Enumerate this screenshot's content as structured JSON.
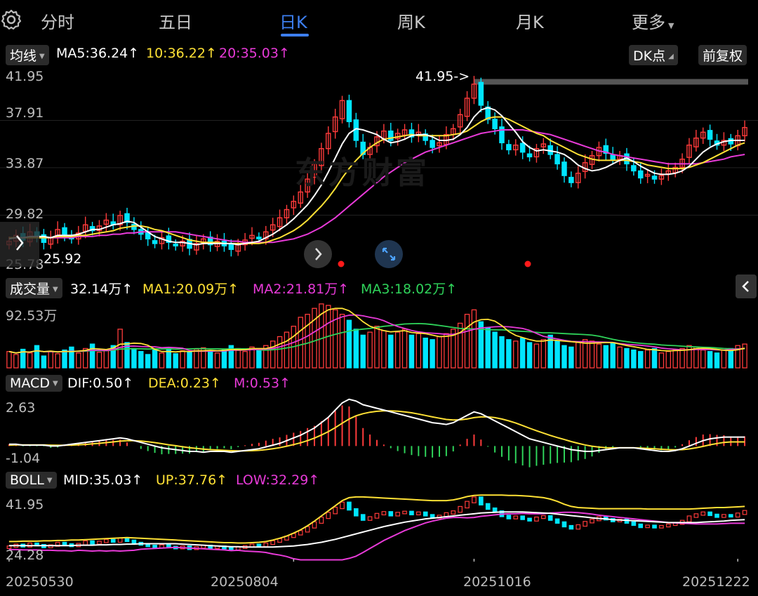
{
  "tabs": [
    "分时",
    "五日",
    "日K",
    "周K",
    "月K",
    "更多"
  ],
  "active_tab": 2,
  "main_legend": {
    "selector": "均线",
    "ma5": "MA5:36.24↑",
    "ma10": "10:36.22↑",
    "ma20": "20:35.03↑",
    "dk_button": "DK点",
    "fq_button": "前复权"
  },
  "main_axis": [
    "41.95",
    "37.91",
    "33.87",
    "29.82",
    "25.78"
  ],
  "annotations": {
    "high_label": "41.95->",
    "low_label": "25.92"
  },
  "watermark": "东方财富",
  "volume_legend": {
    "selector": "成交量",
    "value": "32.14万↑",
    "ma1": "MA1:20.09万↑",
    "ma2": "MA2:21.81万↑",
    "ma3": "MA3:18.02万↑",
    "axis_max": "92.53万"
  },
  "macd_legend": {
    "selector": "MACD",
    "dif": "DIF:0.50↑",
    "dea": "DEA:0.23↑",
    "m": "M:0.53↑",
    "axis_max": "2.63",
    "axis_min": "-1.04"
  },
  "boll_legend": {
    "selector": "BOLL",
    "mid": "MID:35.03↑",
    "up": "UP:37.76↑",
    "low": "LOW:32.29↑",
    "axis_max": "41.95",
    "axis_min": "24.28"
  },
  "dates": [
    "20250530",
    "20250804",
    "20251016",
    "20251222"
  ],
  "colors": {
    "up": "#ff3b3b",
    "down": "#00e5ff",
    "ma5": "#ffffff",
    "ma10": "#ffe135",
    "ma20": "#e83ad8",
    "ma3": "#2fd35a",
    "accent": "#3d7ff0"
  },
  "chart_data": {
    "type": "candlestick",
    "range": [
      25.78,
      41.95
    ],
    "high": 41.95,
    "low": 25.92,
    "closes": [
      27.6,
      28.1,
      27.7,
      28.4,
      28.0,
      27.5,
      27.9,
      28.6,
      28.2,
      27.8,
      28.3,
      29.0,
      28.5,
      28.9,
      29.4,
      29.0,
      29.8,
      29.2,
      28.6,
      28.2,
      27.8,
      27.4,
      27.9,
      27.5,
      27.2,
      27.6,
      27.0,
      27.4,
      27.8,
      27.3,
      27.6,
      27.2,
      26.9,
      27.3,
      27.7,
      28.1,
      27.8,
      28.4,
      29.0,
      29.6,
      30.3,
      31.0,
      31.8,
      32.9,
      34.2,
      35.5,
      36.8,
      38.2,
      39.6,
      37.8,
      36.2,
      35.0,
      35.6,
      36.5,
      37.0,
      36.2,
      36.8,
      37.1,
      36.5,
      36.9,
      36.2,
      35.6,
      36.0,
      36.7,
      37.2,
      38.4,
      39.8,
      41.0,
      39.2,
      38.0,
      37.2,
      36.0,
      35.4,
      35.8,
      35.2,
      34.8,
      35.5,
      35.9,
      35.0,
      34.2,
      33.2,
      32.6,
      33.4,
      34.3,
      34.9,
      35.6,
      35.1,
      34.6,
      34.9,
      34.2,
      33.6,
      33.0,
      33.3,
      32.9,
      33.2,
      33.6,
      33.9,
      34.6,
      35.8,
      36.4,
      36.9,
      36.3,
      35.8,
      36.2,
      35.9,
      36.6,
      37.3
    ],
    "ma5": [
      27.8,
      27.9,
      27.9,
      28.0,
      28.0,
      28.0,
      27.9,
      28.1,
      28.1,
      28.1,
      28.2,
      28.4,
      28.6,
      28.6,
      28.8,
      29.0,
      29.1,
      29.3,
      29.2,
      28.8,
      28.4,
      28.0,
      27.8,
      27.6,
      27.5,
      27.5,
      27.4,
      27.3,
      27.4,
      27.4,
      27.4,
      27.4,
      27.4,
      27.3,
      27.4,
      27.5,
      27.6,
      27.9,
      28.2,
      28.6,
      29.0,
      29.5,
      30.1,
      30.7,
      31.5,
      32.4,
      33.5,
      34.7,
      35.9,
      36.8,
      37.2,
      37.1,
      36.9,
      36.7,
      36.3,
      36.0,
      36.1,
      36.3,
      36.6,
      36.7,
      36.7,
      36.5,
      36.2,
      36.2,
      36.3,
      36.7,
      37.3,
      38.2,
      38.8,
      39.0,
      38.8,
      38.3,
      37.6,
      36.9,
      36.1,
      35.6,
      35.3,
      35.4,
      35.3,
      35.2,
      35.0,
      34.6,
      34.1,
      33.8,
      33.6,
      33.7,
      33.9,
      34.2,
      34.5,
      34.7,
      34.4,
      34.0,
      33.7,
      33.4,
      33.3,
      33.3,
      33.4,
      33.6,
      34.0,
      34.6,
      35.2,
      35.6,
      35.9,
      36.1,
      36.2,
      36.2,
      36.2
    ],
    "ma10": [
      27.9,
      27.9,
      27.9,
      27.9,
      27.9,
      27.9,
      27.9,
      28.0,
      28.0,
      28.0,
      28.1,
      28.1,
      28.2,
      28.3,
      28.4,
      28.5,
      28.7,
      28.8,
      28.9,
      28.9,
      28.8,
      28.6,
      28.5,
      28.3,
      28.1,
      27.9,
      27.7,
      27.6,
      27.5,
      27.5,
      27.5,
      27.4,
      27.4,
      27.4,
      27.4,
      27.4,
      27.4,
      27.5,
      27.7,
      27.9,
      28.2,
      28.5,
      28.9,
      29.4,
      30.0,
      30.6,
      31.3,
      32.1,
      33.0,
      33.8,
      34.5,
      35.1,
      35.6,
      36.0,
      36.3,
      36.4,
      36.5,
      36.6,
      36.7,
      36.6,
      36.6,
      36.6,
      36.6,
      36.6,
      36.7,
      36.8,
      37.0,
      37.4,
      37.8,
      38.1,
      38.2,
      38.2,
      38.0,
      37.7,
      37.4,
      37.1,
      36.8,
      36.6,
      36.2,
      35.9,
      35.6,
      35.3,
      35.0,
      34.8,
      34.6,
      34.5,
      34.5,
      34.5,
      34.5,
      34.5,
      34.4,
      34.3,
      34.1,
      34.0,
      33.9,
      33.8,
      33.8,
      33.8,
      33.9,
      34.1,
      34.3,
      34.6,
      34.9,
      35.2,
      35.5,
      35.8,
      36.0
    ],
    "ma20": [
      27.9,
      27.9,
      27.9,
      27.9,
      27.9,
      27.9,
      27.9,
      27.9,
      27.9,
      27.9,
      28.0,
      28.0,
      28.0,
      28.1,
      28.1,
      28.2,
      28.2,
      28.3,
      28.3,
      28.4,
      28.4,
      28.4,
      28.4,
      28.4,
      28.4,
      28.3,
      28.2,
      28.1,
      28.0,
      27.9,
      27.8,
      27.7,
      27.6,
      27.6,
      27.5,
      27.5,
      27.5,
      27.5,
      27.5,
      27.6,
      27.7,
      27.8,
      28.0,
      28.2,
      28.5,
      28.8,
      29.2,
      29.6,
      30.1,
      30.6,
      31.1,
      31.6,
      32.1,
      32.6,
      33.1,
      33.5,
      33.9,
      34.3,
      34.6,
      34.9,
      35.2,
      35.4,
      35.6,
      35.8,
      36.0,
      36.2,
      36.4,
      36.6,
      36.8,
      36.9,
      37.0,
      37.1,
      37.1,
      37.1,
      37.1,
      37.0,
      36.9,
      36.8,
      36.7,
      36.5,
      36.3,
      36.1,
      35.9,
      35.7,
      35.5,
      35.3,
      35.2,
      35.0,
      34.9,
      34.8,
      34.7,
      34.6,
      34.5,
      34.4,
      34.3,
      34.2,
      34.2,
      34.2,
      34.2,
      34.2,
      34.3,
      34.4,
      34.5,
      34.6,
      34.8,
      34.9,
      35.0
    ],
    "volume_max_wan": 92.53,
    "volumes": [
      22,
      18,
      25,
      20,
      30,
      16,
      22,
      19,
      24,
      28,
      20,
      26,
      32,
      21,
      24,
      30,
      52,
      34,
      26,
      22,
      18,
      24,
      20,
      26,
      19,
      23,
      21,
      25,
      27,
      22,
      20,
      24,
      30,
      26,
      22,
      28,
      24,
      30,
      36,
      42,
      48,
      56,
      68,
      72,
      80,
      86,
      84,
      78,
      72,
      64,
      52,
      44,
      48,
      56,
      50,
      44,
      48,
      52,
      44,
      46,
      40,
      38,
      42,
      46,
      52,
      60,
      72,
      78,
      62,
      54,
      48,
      42,
      38,
      36,
      40,
      34,
      32,
      38,
      44,
      36,
      30,
      28,
      34,
      38,
      36,
      32,
      30,
      34,
      28,
      26,
      24,
      22,
      24,
      26,
      20,
      22,
      24,
      26,
      30,
      28,
      24,
      22,
      20,
      24,
      26,
      30,
      32
    ],
    "macd": {
      "range": [
        -1.04,
        2.63
      ],
      "dif": [
        0.1,
        0.1,
        0.05,
        0.05,
        0.05,
        0.05,
        0.0,
        0.0,
        0.05,
        0.1,
        0.15,
        0.2,
        0.25,
        0.3,
        0.35,
        0.4,
        0.45,
        0.4,
        0.3,
        0.2,
        0.1,
        0.0,
        -0.1,
        -0.15,
        -0.2,
        -0.25,
        -0.3,
        -0.3,
        -0.35,
        -0.3,
        -0.3,
        -0.3,
        -0.35,
        -0.3,
        -0.25,
        -0.2,
        -0.15,
        -0.05,
        0.05,
        0.15,
        0.3,
        0.45,
        0.6,
        0.8,
        1.0,
        1.3,
        1.6,
        2.0,
        2.4,
        2.6,
        2.5,
        2.3,
        2.2,
        2.1,
        2.0,
        1.9,
        1.8,
        1.7,
        1.6,
        1.5,
        1.4,
        1.3,
        1.25,
        1.2,
        1.3,
        1.5,
        1.7,
        1.9,
        1.8,
        1.6,
        1.4,
        1.2,
        1.0,
        0.8,
        0.6,
        0.4,
        0.3,
        0.2,
        0.1,
        0.0,
        -0.1,
        -0.2,
        -0.25,
        -0.3,
        -0.3,
        -0.25,
        -0.2,
        -0.15,
        -0.1,
        -0.1,
        -0.1,
        -0.15,
        -0.2,
        -0.25,
        -0.3,
        -0.3,
        -0.25,
        -0.15,
        0.0,
        0.15,
        0.3,
        0.4,
        0.45,
        0.5,
        0.5,
        0.5,
        0.5
      ],
      "dea": [
        0.05,
        0.06,
        0.06,
        0.06,
        0.06,
        0.06,
        0.05,
        0.04,
        0.04,
        0.05,
        0.07,
        0.09,
        0.12,
        0.15,
        0.19,
        0.23,
        0.27,
        0.3,
        0.3,
        0.28,
        0.24,
        0.19,
        0.13,
        0.07,
        0.02,
        -0.04,
        -0.09,
        -0.13,
        -0.17,
        -0.2,
        -0.22,
        -0.24,
        -0.26,
        -0.27,
        -0.27,
        -0.26,
        -0.24,
        -0.2,
        -0.15,
        -0.09,
        -0.01,
        0.08,
        0.18,
        0.3,
        0.44,
        0.61,
        0.8,
        1.02,
        1.27,
        1.5,
        1.68,
        1.8,
        1.88,
        1.93,
        1.96,
        1.96,
        1.94,
        1.9,
        1.85,
        1.78,
        1.7,
        1.62,
        1.55,
        1.48,
        1.45,
        1.46,
        1.5,
        1.58,
        1.62,
        1.62,
        1.58,
        1.5,
        1.4,
        1.28,
        1.14,
        0.99,
        0.85,
        0.72,
        0.59,
        0.47,
        0.36,
        0.25,
        0.15,
        0.06,
        -0.01,
        -0.06,
        -0.09,
        -0.1,
        -0.1,
        -0.1,
        -0.1,
        -0.11,
        -0.13,
        -0.15,
        -0.18,
        -0.2,
        -0.21,
        -0.2,
        -0.16,
        -0.1,
        -0.02,
        0.07,
        0.14,
        0.2,
        0.23,
        0.23,
        0.23
      ]
    },
    "boll": {
      "range": [
        24.28,
        41.95
      ],
      "mid": [
        27.9,
        27.9,
        27.9,
        27.9,
        27.9,
        27.9,
        27.9,
        27.9,
        27.9,
        27.9,
        28.0,
        28.0,
        28.0,
        28.1,
        28.1,
        28.2,
        28.2,
        28.3,
        28.3,
        28.4,
        28.4,
        28.4,
        28.4,
        28.4,
        28.4,
        28.3,
        28.2,
        28.1,
        28.0,
        27.9,
        27.8,
        27.7,
        27.6,
        27.6,
        27.5,
        27.5,
        27.5,
        27.5,
        27.5,
        27.6,
        27.7,
        27.8,
        28.0,
        28.2,
        28.5,
        28.8,
        29.2,
        29.6,
        30.1,
        30.6,
        31.1,
        31.6,
        32.1,
        32.6,
        33.1,
        33.5,
        33.9,
        34.3,
        34.6,
        34.9,
        35.2,
        35.4,
        35.6,
        35.8,
        36.0,
        36.2,
        36.4,
        36.6,
        36.8,
        36.9,
        37.0,
        37.1,
        37.1,
        37.1,
        37.1,
        37.0,
        36.9,
        36.8,
        36.7,
        36.5,
        36.3,
        36.1,
        35.9,
        35.7,
        35.5,
        35.3,
        35.2,
        35.0,
        34.9,
        34.8,
        34.7,
        34.6,
        34.5,
        34.4,
        34.3,
        34.2,
        34.2,
        34.2,
        34.2,
        34.2,
        34.3,
        34.4,
        34.5,
        34.6,
        34.8,
        34.9,
        35.0
      ],
      "up": [
        29.0,
        29.0,
        29.1,
        29.1,
        29.1,
        29.2,
        29.2,
        29.3,
        29.3,
        29.4,
        29.4,
        29.5,
        29.6,
        29.7,
        29.8,
        29.9,
        30.0,
        30.1,
        30.0,
        29.9,
        29.8,
        29.7,
        29.6,
        29.5,
        29.4,
        29.3,
        29.2,
        29.1,
        29.0,
        28.9,
        28.8,
        28.7,
        28.7,
        28.6,
        28.6,
        28.7,
        28.8,
        29.0,
        29.4,
        29.9,
        30.5,
        31.3,
        32.2,
        33.3,
        34.6,
        36.0,
        37.4,
        38.8,
        40.2,
        41.0,
        41.2,
        41.2,
        41.1,
        41.0,
        40.9,
        40.8,
        40.7,
        40.6,
        40.5,
        40.4,
        40.3,
        40.2,
        40.2,
        40.2,
        40.4,
        40.8,
        41.3,
        41.6,
        41.7,
        41.7,
        41.7,
        41.7,
        41.6,
        41.6,
        41.5,
        41.4,
        41.2,
        41.0,
        40.6,
        40.0,
        39.2,
        38.6,
        38.3,
        38.2,
        38.1,
        38.0,
        38.0,
        38.0,
        38.0,
        38.0,
        38.0,
        38.0,
        37.9,
        37.9,
        37.9,
        37.9,
        37.9,
        37.9,
        37.9,
        38.0,
        38.1,
        38.2,
        38.3,
        38.3,
        38.4,
        38.5,
        38.6
      ],
      "low": [
        26.8,
        26.8,
        26.7,
        26.7,
        26.7,
        26.6,
        26.6,
        26.5,
        26.5,
        26.4,
        26.6,
        26.5,
        26.4,
        26.5,
        26.4,
        26.5,
        26.4,
        26.5,
        26.6,
        26.9,
        27.0,
        27.1,
        27.2,
        27.3,
        27.4,
        27.3,
        27.2,
        27.1,
        27.0,
        26.9,
        26.8,
        26.7,
        26.5,
        26.6,
        26.4,
        26.3,
        26.2,
        26.0,
        25.6,
        25.3,
        24.9,
        24.3,
        24.0,
        24.0,
        24.0,
        24.0,
        24.0,
        24.0,
        24.0,
        24.4,
        25.0,
        26.0,
        27.1,
        28.2,
        29.3,
        30.2,
        31.1,
        32.0,
        32.7,
        33.4,
        34.1,
        34.6,
        35.0,
        35.4,
        35.6,
        35.6,
        35.5,
        35.6,
        35.9,
        36.1,
        36.3,
        36.5,
        36.6,
        36.6,
        36.7,
        36.6,
        36.6,
        36.6,
        36.8,
        36.9,
        37.0,
        37.0,
        36.9,
        36.7,
        36.5,
        36.2,
        36.0,
        35.8,
        35.6,
        35.4,
        35.2,
        35.0,
        34.8,
        34.6,
        34.4,
        34.2,
        34.1,
        34.0,
        33.9,
        33.8,
        33.8,
        33.8,
        33.8,
        33.9,
        34.0,
        34.0,
        34.0
      ]
    }
  }
}
